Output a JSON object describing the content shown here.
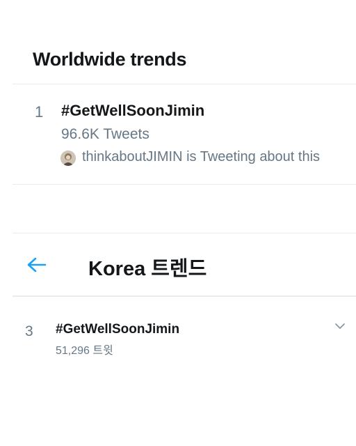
{
  "worldwide": {
    "title": "Worldwide trends",
    "trend": {
      "rank": "1",
      "name": "#GetWellSoonJimin",
      "tweet_count": "96.6K Tweets",
      "context": "thinkaboutJIMIN is Tweeting about this"
    }
  },
  "korea": {
    "title": "Korea 트렌드",
    "trend": {
      "rank": "3",
      "name": "#GetWellSoonJimin",
      "tweet_count": "51,296 트윗"
    }
  },
  "icons": {
    "back": "back-arrow-icon",
    "more": "chevron-down-icon",
    "avatar": "user-avatar"
  },
  "colors": {
    "text_primary": "#14171a",
    "text_secondary": "#657786",
    "accent": "#1da1f2",
    "divider": "#e6ecf0"
  }
}
